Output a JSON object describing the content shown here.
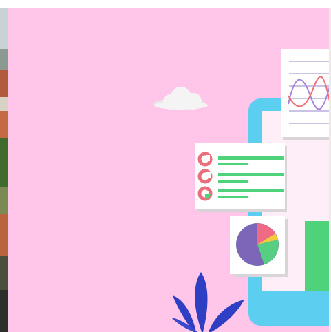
{
  "colors": {
    "background": "#ffc6ea",
    "tablet_frame": "#5ccff0",
    "tablet_screen": "#fdeef8",
    "accent_green": "#4fd37a",
    "accent_red": "#e86f7b",
    "pie_purple": "#7b66b8",
    "pie_pink": "#f06a86",
    "pie_yellow": "#f3c93d",
    "pie_green": "#56cf83",
    "leaf_blue": "#2e3fc4",
    "cloud": "#f4f4f4",
    "chart_purple": "#a383dc",
    "chart_red": "#ef6f78"
  },
  "icons": {
    "cloud": "cloud-icon",
    "list_card": "checklist-card-icon",
    "pie_card": "pie-chart-card-icon",
    "line_card": "line-chart-card-icon",
    "plant": "plant-leaves-icon",
    "tablet": "tablet-device-icon"
  }
}
